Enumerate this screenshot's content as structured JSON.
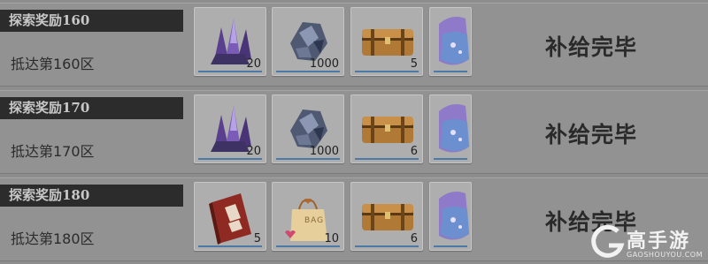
{
  "rows": [
    {
      "title": "探索奖励160",
      "reach": "抵达第160区",
      "status": "补给完毕",
      "items": [
        {
          "icon": "purple-crystal-icon",
          "qty": "20"
        },
        {
          "icon": "metal-ore-icon",
          "qty": "1000"
        },
        {
          "icon": "treasure-chest-icon",
          "qty": "5"
        },
        {
          "icon": "potion-bottle-icon",
          "qty": ""
        }
      ]
    },
    {
      "title": "探索奖励170",
      "reach": "抵达第170区",
      "status": "补给完毕",
      "items": [
        {
          "icon": "purple-crystal-icon",
          "qty": "20"
        },
        {
          "icon": "metal-ore-icon",
          "qty": "1000"
        },
        {
          "icon": "treasure-chest-icon",
          "qty": "6"
        },
        {
          "icon": "potion-bottle-icon",
          "qty": ""
        }
      ]
    },
    {
      "title": "探索奖励180",
      "reach": "抵达第180区",
      "status": "补给完毕",
      "items": [
        {
          "icon": "red-book-icon",
          "qty": "5"
        },
        {
          "icon": "gift-bag-icon",
          "qty": "10",
          "label": "BAG"
        },
        {
          "icon": "treasure-chest-icon",
          "qty": "6"
        },
        {
          "icon": "potion-bottle-icon",
          "qty": ""
        }
      ]
    }
  ],
  "watermark": {
    "name": "高手游",
    "url": "GAOSHOUYOU.COM"
  }
}
